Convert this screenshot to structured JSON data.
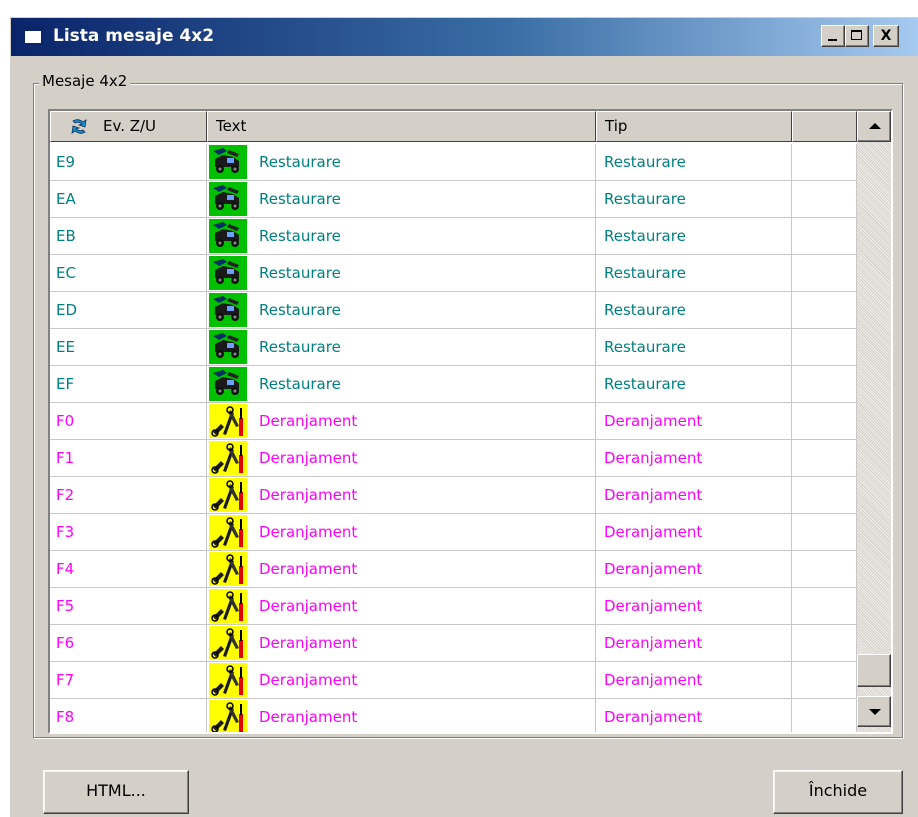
{
  "window": {
    "title": "Lista mesaje 4x2",
    "controls": {
      "minimize": "_",
      "maximize": "□",
      "close": "X"
    }
  },
  "group": {
    "label": "Mesaje 4x2"
  },
  "table": {
    "columns": [
      "Ev. Z/U",
      "Text",
      "Tip",
      ""
    ],
    "rows": [
      {
        "code": "E9",
        "text": "Restaurare",
        "tip": "Restaurare",
        "kind": "restaurare"
      },
      {
        "code": "EA",
        "text": "Restaurare",
        "tip": "Restaurare",
        "kind": "restaurare"
      },
      {
        "code": "EB",
        "text": "Restaurare",
        "tip": "Restaurare",
        "kind": "restaurare"
      },
      {
        "code": "EC",
        "text": "Restaurare",
        "tip": "Restaurare",
        "kind": "restaurare"
      },
      {
        "code": "ED",
        "text": "Restaurare",
        "tip": "Restaurare",
        "kind": "restaurare"
      },
      {
        "code": "EE",
        "text": "Restaurare",
        "tip": "Restaurare",
        "kind": "restaurare"
      },
      {
        "code": "EF",
        "text": "Restaurare",
        "tip": "Restaurare",
        "kind": "restaurare"
      },
      {
        "code": "F0",
        "text": "Deranjament",
        "tip": "Deranjament",
        "kind": "deranjament"
      },
      {
        "code": "F1",
        "text": "Deranjament",
        "tip": "Deranjament",
        "kind": "deranjament"
      },
      {
        "code": "F2",
        "text": "Deranjament",
        "tip": "Deranjament",
        "kind": "deranjament"
      },
      {
        "code": "F3",
        "text": "Deranjament",
        "tip": "Deranjament",
        "kind": "deranjament"
      },
      {
        "code": "F4",
        "text": "Deranjament",
        "tip": "Deranjament",
        "kind": "deranjament"
      },
      {
        "code": "F5",
        "text": "Deranjament",
        "tip": "Deranjament",
        "kind": "deranjament"
      },
      {
        "code": "F6",
        "text": "Deranjament",
        "tip": "Deranjament",
        "kind": "deranjament"
      },
      {
        "code": "F7",
        "text": "Deranjament",
        "tip": "Deranjament",
        "kind": "deranjament"
      },
      {
        "code": "F8",
        "text": "Deranjament",
        "tip": "Deranjament",
        "kind": "deranjament"
      }
    ]
  },
  "colors": {
    "restaurare": "#008080",
    "deranjament": "#ff00ff",
    "restaurare_icon_bg": "#00c000",
    "deranjament_icon_bg": "#ffff00"
  },
  "icons": {
    "restaurare": "tow-truck-icon",
    "deranjament": "repair-tools-icon",
    "sort": "sort-arrow-icon"
  },
  "buttons": {
    "html": "HTML...",
    "close": "Închide"
  }
}
